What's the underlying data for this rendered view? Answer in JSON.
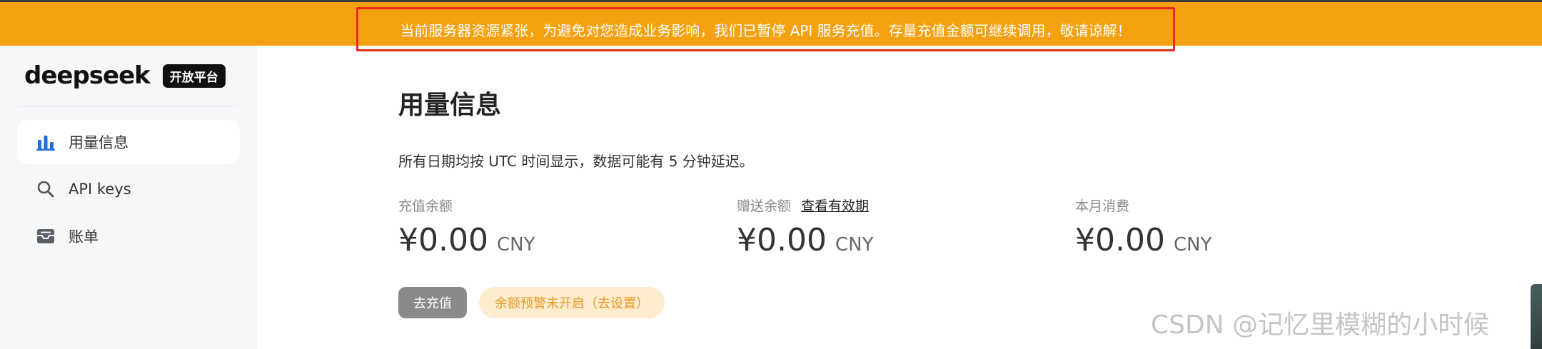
{
  "banner": {
    "text": "当前服务器资源紧张，为避免对您造成业务影响，我们已暂停 API 服务充值。存量充值金额可继续调用，敬请谅解！"
  },
  "brand": {
    "name": "deepseek",
    "badge": "开放平台"
  },
  "sidebar": {
    "items": [
      {
        "label": "用量信息",
        "icon": "bar-chart-icon",
        "active": true
      },
      {
        "label": "API keys",
        "icon": "search-icon",
        "active": false
      },
      {
        "label": "账单",
        "icon": "mailbox-icon",
        "active": false
      }
    ]
  },
  "main": {
    "title": "用量信息",
    "description": "所有日期均按 UTC 时间显示，数据可能有 5 分钟延迟。",
    "stats": [
      {
        "label": "充值余额",
        "amount": "¥0.00",
        "unit": "CNY"
      },
      {
        "label": "赠送余额",
        "link": "查看有效期",
        "amount": "¥0.00",
        "unit": "CNY"
      },
      {
        "label": "本月消费",
        "amount": "¥0.00",
        "unit": "CNY"
      }
    ],
    "recharge_button": "去充值",
    "alert_pill": "余额预警未开启（去设置）"
  },
  "watermark": "CSDN @记忆里模糊的小时候",
  "colors": {
    "banner_bg": "#f5a00f",
    "banner_outline": "#e8291c",
    "active_icon": "#1f6fe0",
    "alert_text": "#e89a2a"
  }
}
